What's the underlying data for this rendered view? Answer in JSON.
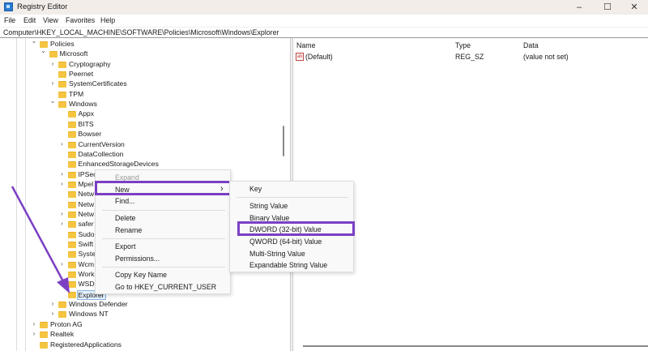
{
  "window": {
    "title": "Registry Editor",
    "minimize": "–",
    "maximize": "☐",
    "close": "✕"
  },
  "menubar": [
    "File",
    "Edit",
    "View",
    "Favorites",
    "Help"
  ],
  "address": "Computer\\HKEY_LOCAL_MACHINE\\SOFTWARE\\Policies\\Microsoft\\Windows\\Explorer",
  "tree": [
    {
      "label": "Policies",
      "depth": 0,
      "chev": "open"
    },
    {
      "label": "Microsoft",
      "depth": 1,
      "chev": "open"
    },
    {
      "label": "Cryptography",
      "depth": 2,
      "chev": "closed"
    },
    {
      "label": "Peernet",
      "depth": 2,
      "chev": "none"
    },
    {
      "label": "SystemCertificates",
      "depth": 2,
      "chev": "closed"
    },
    {
      "label": "TPM",
      "depth": 2,
      "chev": "none"
    },
    {
      "label": "Windows",
      "depth": 2,
      "chev": "open"
    },
    {
      "label": "Appx",
      "depth": 3,
      "chev": "none"
    },
    {
      "label": "BITS",
      "depth": 3,
      "chev": "none"
    },
    {
      "label": "Bowser",
      "depth": 3,
      "chev": "none"
    },
    {
      "label": "CurrentVersion",
      "depth": 3,
      "chev": "closed"
    },
    {
      "label": "DataCollection",
      "depth": 3,
      "chev": "none"
    },
    {
      "label": "EnhancedStorageDevices",
      "depth": 3,
      "chev": "none"
    },
    {
      "label": "IPSec",
      "depth": 3,
      "chev": "closed"
    },
    {
      "label": "Mpel",
      "depth": 3,
      "chev": "closed"
    },
    {
      "label": "Netw",
      "depth": 3,
      "chev": "none"
    },
    {
      "label": "Netw",
      "depth": 3,
      "chev": "none"
    },
    {
      "label": "Netw",
      "depth": 3,
      "chev": "closed"
    },
    {
      "label": "safer",
      "depth": 3,
      "chev": "closed"
    },
    {
      "label": "Sudo",
      "depth": 3,
      "chev": "none"
    },
    {
      "label": "Swift",
      "depth": 3,
      "chev": "none"
    },
    {
      "label": "Syste",
      "depth": 3,
      "chev": "none"
    },
    {
      "label": "Wcm",
      "depth": 3,
      "chev": "closed"
    },
    {
      "label": "Work",
      "depth": 3,
      "chev": "none"
    },
    {
      "label": "WSD.",
      "depth": 3,
      "chev": "none"
    },
    {
      "label": "Explorer",
      "depth": 3,
      "chev": "none",
      "selected": true
    },
    {
      "label": "Windows Defender",
      "depth": 2,
      "chev": "closed"
    },
    {
      "label": "Windows NT",
      "depth": 2,
      "chev": "closed"
    },
    {
      "label": "Proton AG",
      "depth": 0,
      "chev": "closed"
    },
    {
      "label": "Realtek",
      "depth": 0,
      "chev": "closed"
    },
    {
      "label": "RegisteredApplications",
      "depth": 0,
      "chev": "none"
    }
  ],
  "values": {
    "headers": {
      "name": "Name",
      "type": "Type",
      "data": "Data"
    },
    "rows": [
      {
        "icon": "ab",
        "name": "(Default)",
        "type": "REG_SZ",
        "data": "(value not set)"
      }
    ]
  },
  "context_menu": {
    "expand": "Expand",
    "new": "New",
    "new_arrow": "›",
    "find": "Find...",
    "delete": "Delete",
    "rename": "Rename",
    "export": "Export",
    "permissions": "Permissions...",
    "copy_key_name": "Copy Key Name",
    "goto_hkcu": "Go to HKEY_CURRENT_USER"
  },
  "submenu": {
    "key": "Key",
    "string": "String Value",
    "binary": "Binary Value",
    "dword": "DWORD (32-bit) Value",
    "qword": "QWORD (64-bit) Value",
    "multi": "Multi-String Value",
    "expandable": "Expandable String Value"
  },
  "colors": {
    "highlight": "#7b3fc4",
    "folder": "#f5c542",
    "titlebar": "#f3ede9"
  }
}
